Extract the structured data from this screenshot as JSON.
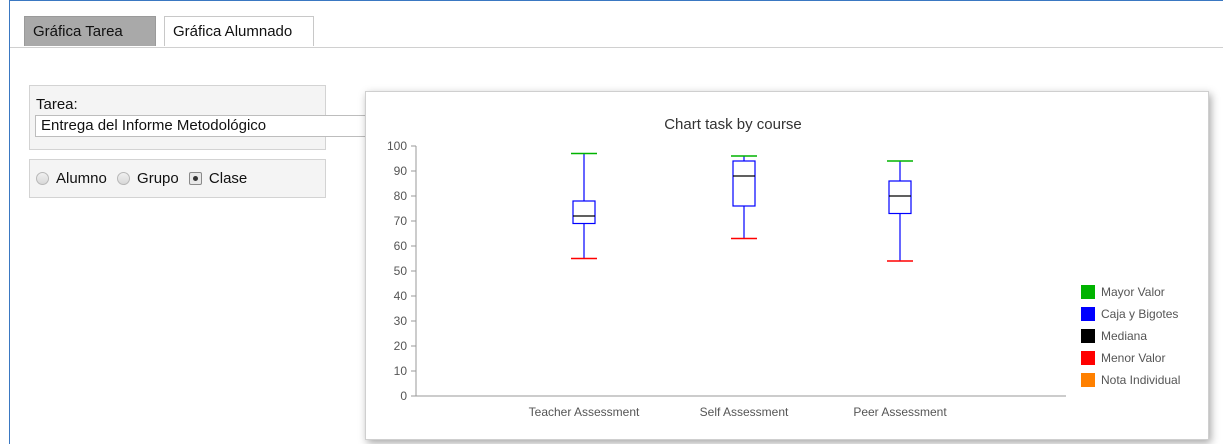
{
  "tabs": [
    {
      "label": "Gráfica Tarea",
      "active": true
    },
    {
      "label": "Gráfica Alumnado",
      "active": false
    }
  ],
  "tarea": {
    "label": "Tarea:",
    "selected": "Entrega del Informe Metodológico"
  },
  "view_options": [
    {
      "label": "Alumno",
      "checked": false
    },
    {
      "label": "Grupo",
      "checked": false
    },
    {
      "label": "Clase",
      "checked": true
    }
  ],
  "chart_data": {
    "type": "box",
    "title": "Chart task by course",
    "xlabel": "",
    "ylabel": "",
    "ylim": [
      0,
      100
    ],
    "yticks": [
      0,
      10,
      20,
      30,
      40,
      50,
      60,
      70,
      80,
      90,
      100
    ],
    "categories": [
      "Teacher Assessment",
      "Self Assessment",
      "Peer Assessment"
    ],
    "boxes": [
      {
        "category": "Teacher Assessment",
        "min": 55,
        "q1": 69,
        "median": 72,
        "q3": 78,
        "max": 97
      },
      {
        "category": "Self Assessment",
        "min": 63,
        "q1": 76,
        "median": 88,
        "q3": 94,
        "max": 96
      },
      {
        "category": "Peer Assessment",
        "min": 54,
        "q1": 73,
        "median": 80,
        "q3": 86,
        "max": 94
      }
    ],
    "legend": [
      {
        "label": "Mayor Valor",
        "color": "#00b300"
      },
      {
        "label": "Caja y Bigotes",
        "color": "#0000ff"
      },
      {
        "label": "Mediana",
        "color": "#000000"
      },
      {
        "label": "Menor Valor",
        "color": "#ff0000"
      },
      {
        "label": "Nota Individual",
        "color": "#ff8000"
      }
    ],
    "legend_position": "right",
    "grid": false,
    "colors": {
      "max": "#00b300",
      "box": "#0000ff",
      "median": "#000000",
      "min": "#ff0000"
    }
  }
}
